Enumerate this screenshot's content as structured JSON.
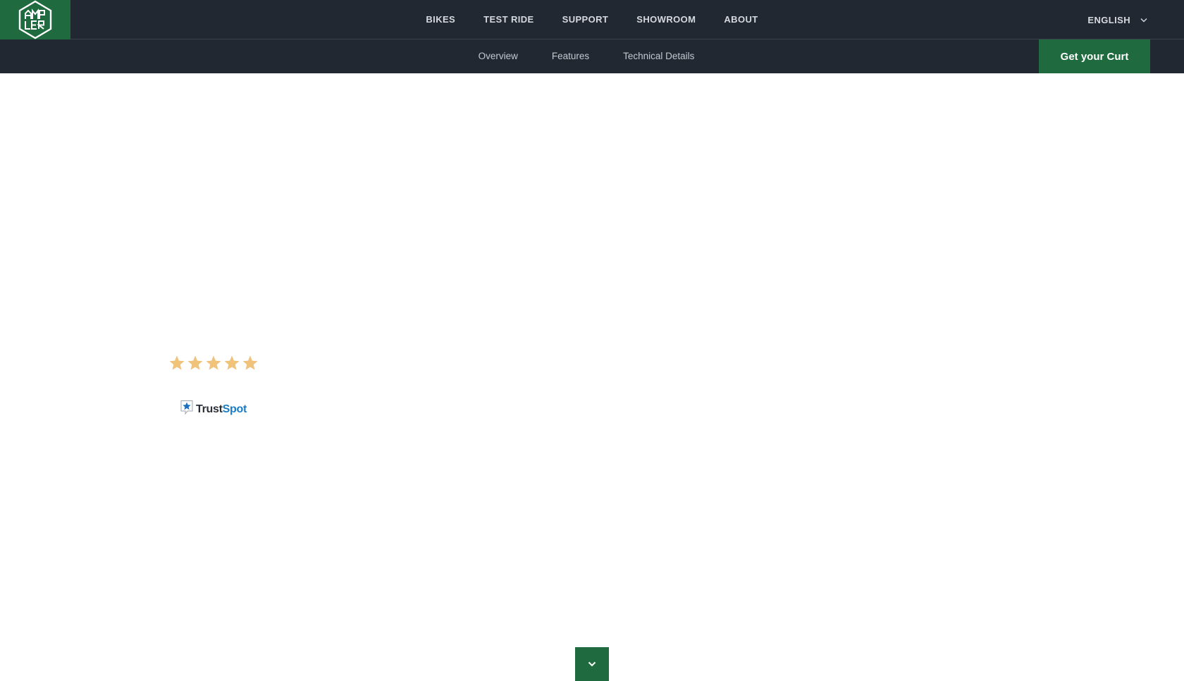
{
  "brand": {
    "logo_text": "AMPLER",
    "logo_icon": "ampler-hexagon-logo",
    "accent_color": "#1f6a3e",
    "bar_color": "#222831"
  },
  "main_nav": {
    "items": [
      {
        "label": "BIKES"
      },
      {
        "label": "TEST RIDE"
      },
      {
        "label": "SUPPORT"
      },
      {
        "label": "SHOWROOM"
      },
      {
        "label": "ABOUT"
      }
    ],
    "language": "ENGLISH",
    "language_icon": "chevron-down-icon"
  },
  "sub_nav": {
    "items": [
      {
        "label": "Overview"
      },
      {
        "label": "Features"
      },
      {
        "label": "Technical Details"
      }
    ],
    "cta_label": "Get your Curt"
  },
  "reviews": {
    "rating": 5,
    "max_rating": 5,
    "star_color": "#f0c27a",
    "provider_part1": "Trust",
    "provider_part2": "Spot",
    "provider_icon": "trustspot-star-icon"
  },
  "scroll_button": {
    "icon": "chevron-down-icon"
  }
}
